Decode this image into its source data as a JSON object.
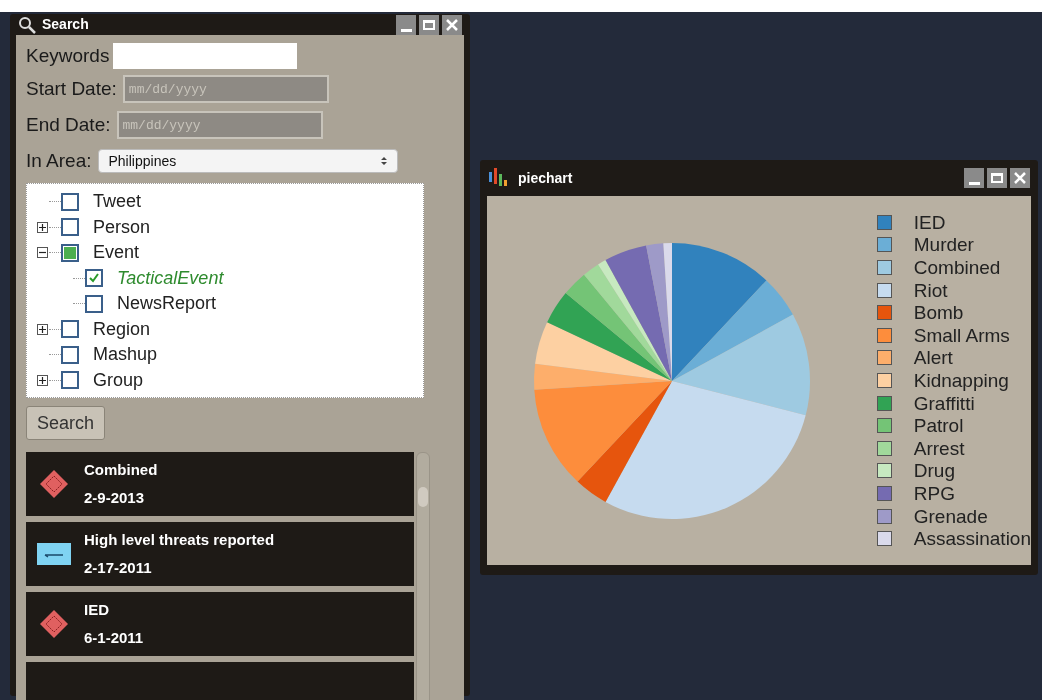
{
  "search_window": {
    "title": "Search",
    "keywords": {
      "label": "Keywords"
    },
    "start_date": {
      "label": "Start Date:",
      "placeholder": "mm/dd/yyyy"
    },
    "end_date": {
      "label": "End Date:",
      "placeholder": "mm/dd/yyyy"
    },
    "area": {
      "label": "In Area:",
      "value": "Philippines"
    },
    "tree": [
      {
        "label": "Tweet",
        "checked": false,
        "partial": false,
        "selected": false
      },
      {
        "label": "Person",
        "checked": false,
        "partial": false,
        "selected": false,
        "expanded": false
      },
      {
        "label": "Event",
        "checked": false,
        "partial": true,
        "selected": false,
        "expanded": true,
        "children": [
          {
            "label": "TacticalEvent",
            "checked": true,
            "partial": false,
            "selected": true
          },
          {
            "label": "NewsReport",
            "checked": false,
            "partial": false,
            "selected": false
          }
        ]
      },
      {
        "label": "Region",
        "checked": false,
        "partial": false,
        "selected": false,
        "expanded": false
      },
      {
        "label": "Mashup",
        "checked": false,
        "partial": false,
        "selected": false
      },
      {
        "label": "Group",
        "checked": false,
        "partial": false,
        "selected": false,
        "expanded": false
      }
    ],
    "search_button": "Search",
    "results": [
      {
        "kind": "diamond",
        "title": "Combined",
        "date": "2-9-2013"
      },
      {
        "kind": "tag",
        "title": "High level threats reported",
        "date": "2-17-2011"
      },
      {
        "kind": "diamond",
        "title": "IED",
        "date": "6-1-2011"
      },
      {
        "kind": "blank"
      }
    ]
  },
  "chart_window": {
    "title": "piechart",
    "legend": [
      {
        "label": "IED",
        "color": "#3182bd"
      },
      {
        "label": "Murder",
        "color": "#6baed6"
      },
      {
        "label": "Combined",
        "color": "#9ecae1"
      },
      {
        "label": "Riot",
        "color": "#c6dbef"
      },
      {
        "label": "Bomb",
        "color": "#e6550d"
      },
      {
        "label": "Small Arms",
        "color": "#fd8d3c"
      },
      {
        "label": "Alert",
        "color": "#fdae6b"
      },
      {
        "label": "Kidnapping",
        "color": "#fdd0a2"
      },
      {
        "label": "Graffitti",
        "color": "#31a354"
      },
      {
        "label": "Patrol",
        "color": "#74c476"
      },
      {
        "label": "Arrest",
        "color": "#a1d99b"
      },
      {
        "label": "Drug",
        "color": "#c7e9c0"
      },
      {
        "label": "RPG",
        "color": "#756bb1"
      },
      {
        "label": "Grenade",
        "color": "#9e9ac8"
      },
      {
        "label": "Assassination",
        "color": "#dadaeb"
      }
    ]
  }
}
